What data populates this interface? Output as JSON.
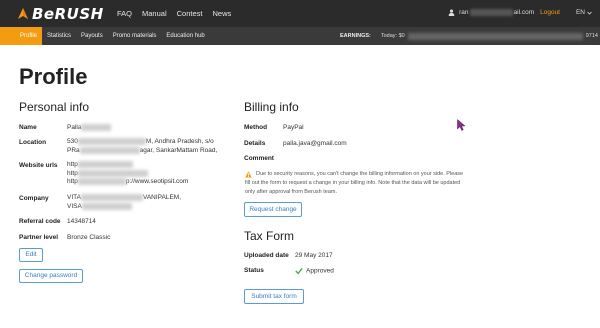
{
  "brand": {
    "name": "BeRUSH"
  },
  "topnav": [
    "FAQ",
    "Manual",
    "Contest",
    "News"
  ],
  "user": {
    "email_start": "ran",
    "email_end": "ail.com",
    "logout": "Logout",
    "lang": "EN"
  },
  "subnav": [
    {
      "label": "Profile",
      "active": true
    },
    {
      "label": "Statistics",
      "active": false
    },
    {
      "label": "Payouts",
      "active": false
    },
    {
      "label": "Promo materials",
      "active": false
    },
    {
      "label": "Education hub",
      "active": false
    }
  ],
  "earnings": {
    "label": "EARNINGS:",
    "today": "Today: $0",
    "tail": "9714"
  },
  "page_title": "Profile",
  "personal": {
    "heading": "Personal info",
    "name_label": "Name",
    "name_value": "Palla",
    "location_label": "Location",
    "location_line1_start": "530",
    "location_line1_end": "M, Andhra Pradesh, s/o",
    "location_line2_start": "PRa",
    "location_line2_end": "agar, SankarMattam Road,",
    "website_label": "Website urls",
    "url_prefix": "http",
    "url3_end": "p://www.seotipsit.com",
    "company_label": "Company",
    "company_line1_start": "VITA",
    "company_line1_end": "VANIPALEM,",
    "company_line2_start": "VISA",
    "referral_label": "Referral code",
    "referral_value": "14348714",
    "partner_label": "Partner level",
    "partner_value": "Bronze Classic",
    "edit_button": "Edit",
    "change_password_button": "Change password"
  },
  "billing": {
    "heading": "Billing info",
    "method_label": "Method",
    "method_value": "PayPal",
    "details_label": "Details",
    "details_value": "palla.java@gmail.com",
    "comment_label": "Comment",
    "notice": "Due to security reasons, you can't change the billing information on your side. Please fill out the form to request a change in your billing info. Note that the data will be updated only after approval from Berush team.",
    "request_button": "Request change"
  },
  "tax": {
    "heading": "Tax Form",
    "uploaded_label": "Uploaded date",
    "uploaded_value": "29 May 2017",
    "status_label": "Status",
    "status_value": "Approved",
    "submit_button": "Submit tax form"
  },
  "colors": {
    "accent": "#f39c12",
    "topbar": "#2b2b2b",
    "subbar": "#3a3a3a",
    "link": "#3a7dc2",
    "success": "#4caf50"
  }
}
